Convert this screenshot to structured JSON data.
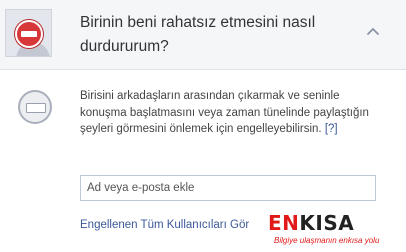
{
  "header": {
    "title": "Birinin beni rahatsız etmesini nasıl durdururum?"
  },
  "body": {
    "description": "Birisini arkadaşların arasından çıkarmak ve seninle konuşma başlatmasını veya zaman tünelinde paylaştığın şeyleri görmesini önlemek için engelleyebilirsin.",
    "help_link": "[?]",
    "input_placeholder": "Ad veya e-posta ekle",
    "blocked_users_link": "Engellenen Tüm Kullanıcıları Gör"
  },
  "watermark": {
    "logo_part1": "EN",
    "logo_part2": "KISA",
    "tagline": "Bilgiye ulaşmanın enkısa yolu"
  },
  "colors": {
    "link": "#3b5998",
    "block_red": "#d8373a",
    "watermark_red": "#e11919"
  },
  "icons": {
    "avatar": "default-avatar-icon",
    "block": "block-icon",
    "collapse": "chevron-up-icon",
    "blocked_circle": "blocked-circle-icon"
  }
}
